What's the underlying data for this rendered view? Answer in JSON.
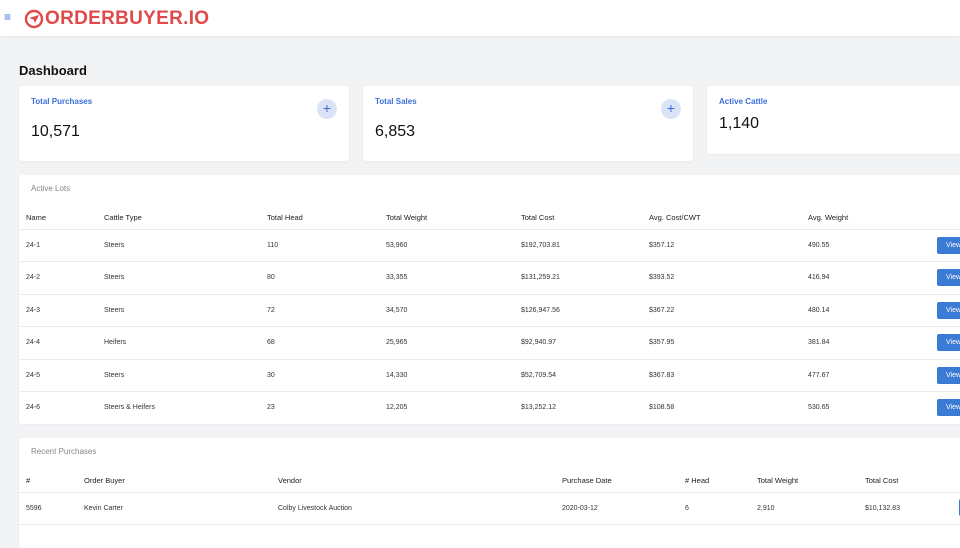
{
  "app": {
    "logo_text": "ORDERBUYER.IO",
    "menu_icon": "hamburger-icon"
  },
  "page": {
    "title": "Dashboard"
  },
  "cards": [
    {
      "label": "Total Purchases",
      "value": "10,571",
      "action": "+"
    },
    {
      "label": "Total Sales",
      "value": "6,853",
      "action": "+"
    },
    {
      "label": "Active Cattle",
      "value": "1,140"
    }
  ],
  "active_lots": {
    "title": "Active Lots",
    "columns": [
      "Name",
      "Cattle Type",
      "Total Head",
      "Total Weight",
      "Total Cost",
      "Avg. Cost/CWT",
      "Avg. Weight"
    ],
    "view_label": "View",
    "rows": [
      [
        "24-1",
        "Steers",
        "110",
        "53,960",
        "$192,703.81",
        "$357.12",
        "490.55"
      ],
      [
        "24-2",
        "Steers",
        "80",
        "33,355",
        "$131,259.21",
        "$393.52",
        "416.94"
      ],
      [
        "24-3",
        "Steers",
        "72",
        "34,570",
        "$126,947.56",
        "$367.22",
        "480.14"
      ],
      [
        "24-4",
        "Heifers",
        "68",
        "25,965",
        "$92,940.97",
        "$357.95",
        "381.84"
      ],
      [
        "24-5",
        "Steers",
        "30",
        "14,330",
        "$52,709.54",
        "$367.83",
        "477.67"
      ],
      [
        "24-6",
        "Steers & Heifers",
        "23",
        "12,205",
        "$13,252.12",
        "$108.58",
        "530.65"
      ]
    ]
  },
  "recent_purchases": {
    "title": "Recent Purchases",
    "columns": [
      "#",
      "Order Buyer",
      "Vendor",
      "Purchase Date",
      "# Head",
      "Total Weight",
      "Total Cost"
    ],
    "rows": [
      [
        "5596",
        "Kevin Carter",
        "Colby Livestock Auction",
        "2020-03-12",
        "6",
        "2,910",
        "$10,132.83"
      ]
    ]
  },
  "colors": {
    "accent": "#3a7bd5",
    "brand": "#e04a4a",
    "background": "#f2f3f5"
  }
}
